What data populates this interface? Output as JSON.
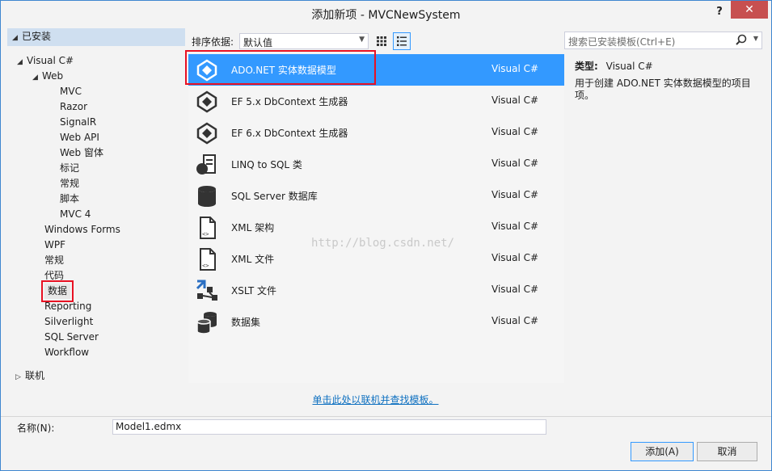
{
  "window": {
    "title": "添加新项 - MVCNewSystem",
    "help": "?",
    "close": "✕"
  },
  "tree": {
    "installed": "已安装",
    "visual_csharp": "Visual C#",
    "web": "Web",
    "web_children": [
      "MVC",
      "Razor",
      "SignalR",
      "Web API",
      "Web 窗体",
      "标记",
      "常规",
      "脚本",
      "MVC 4"
    ],
    "csharp_children": [
      "Windows Forms",
      "WPF",
      "常规",
      "代码",
      "数据",
      "Reporting",
      "Silverlight",
      "SQL Server",
      "Workflow"
    ],
    "online": "联机",
    "selected": "数据"
  },
  "toolbar": {
    "sort_label": "排序依据:",
    "sort_value": "默认值"
  },
  "templates": [
    {
      "name": "ADO.NET 实体数据模型",
      "lang": "Visual C#",
      "icon": "ado-net-icon"
    },
    {
      "name": "EF 5.x DbContext 生成器",
      "lang": "Visual C#",
      "icon": "ef-generator-icon"
    },
    {
      "name": "EF 6.x DbContext 生成器",
      "lang": "Visual C#",
      "icon": "ef-generator-icon"
    },
    {
      "name": "LINQ to SQL 类",
      "lang": "Visual C#",
      "icon": "linq-icon"
    },
    {
      "name": "SQL Server 数据库",
      "lang": "Visual C#",
      "icon": "database-icon"
    },
    {
      "name": "XML 架构",
      "lang": "Visual C#",
      "icon": "xml-file-icon"
    },
    {
      "name": "XML 文件",
      "lang": "Visual C#",
      "icon": "xml-file-icon"
    },
    {
      "name": "XSLT 文件",
      "lang": "Visual C#",
      "icon": "xslt-icon"
    },
    {
      "name": "数据集",
      "lang": "Visual C#",
      "icon": "dataset-icon"
    }
  ],
  "watermark": "http://blog.csdn.net/",
  "search": {
    "placeholder": "搜索已安装模板(Ctrl+E)"
  },
  "detail": {
    "type_label": "类型:",
    "type_value": "Visual C#",
    "description": "用于创建 ADO.NET 实体数据模型的项目项。"
  },
  "online_link": "单击此处以联机并查找模板。",
  "name_field": {
    "label": "名称(N):",
    "value": "Model1.edmx"
  },
  "buttons": {
    "add": "添加(A)",
    "cancel": "取消"
  },
  "colors": {
    "selection": "#3399ff",
    "highlight_box": "#e81123",
    "close": "#c75050",
    "link": "#0e70c0"
  }
}
